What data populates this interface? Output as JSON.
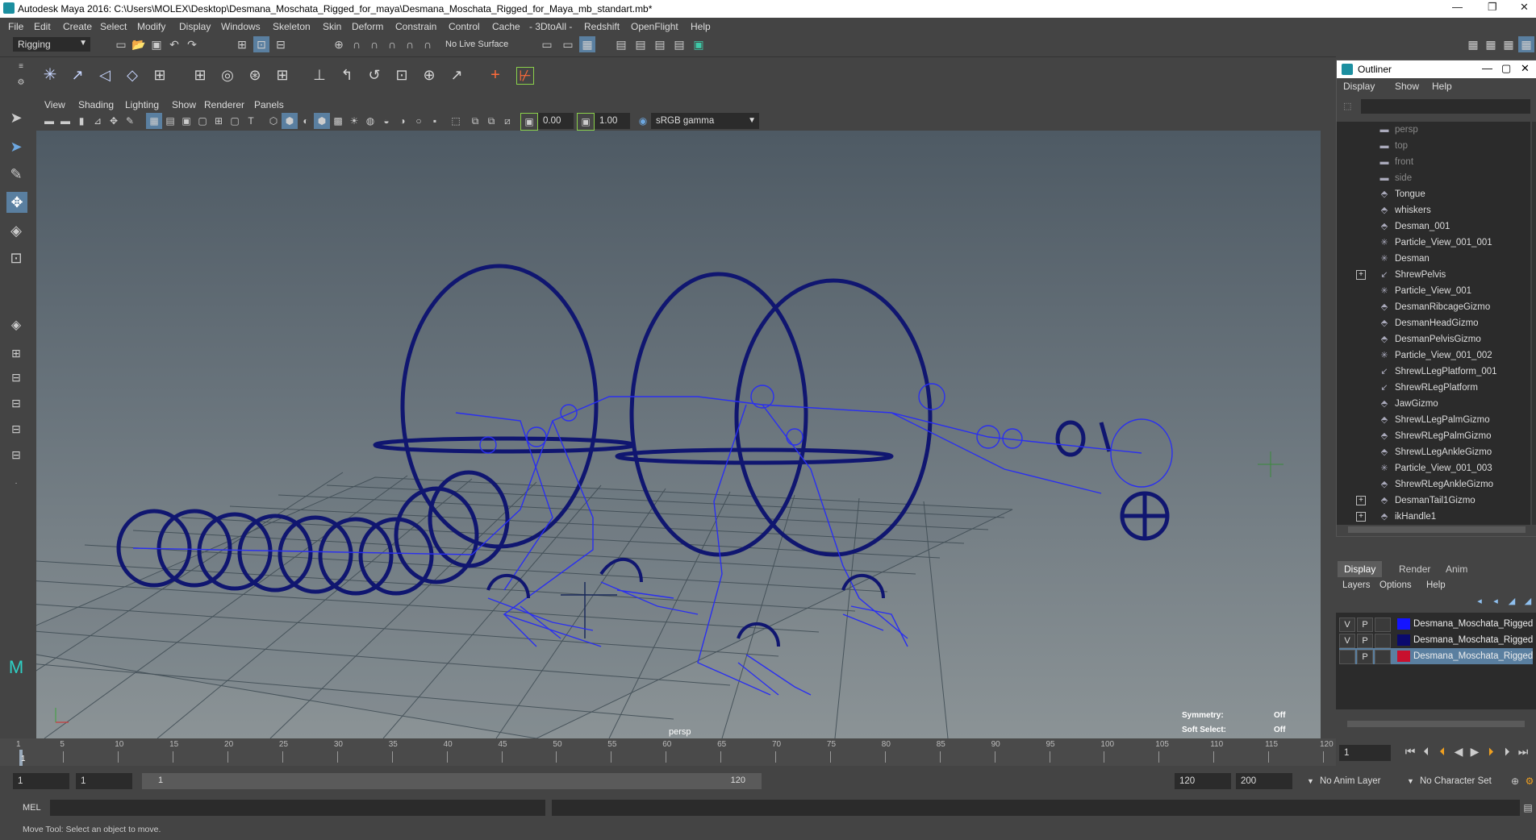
{
  "window": {
    "title": "Autodesk Maya 2016: C:\\Users\\MOLEX\\Desktop\\Desmana_Moschata_Rigged_for_maya\\Desmana_Moschata_Rigged_for_Maya_mb_standart.mb*"
  },
  "menu": [
    "File",
    "Edit",
    "Create",
    "Select",
    "Modify",
    "Display",
    "Windows",
    "Skeleton",
    "Skin",
    "Deform",
    "Constrain",
    "Control",
    "Cache",
    "- 3DtoAll -",
    "Redshift",
    "OpenFlight",
    "Help"
  ],
  "status": {
    "mode": "Rigging",
    "live_surface": "No Live Surface"
  },
  "viewport": {
    "menu": [
      "View",
      "Shading",
      "Lighting",
      "Show",
      "Renderer",
      "Panels"
    ],
    "near": "0.00",
    "far": "1.00",
    "color_space": "sRGB gamma",
    "camera": "persp",
    "symmetry_label": "Symmetry:",
    "symmetry_value": "Off",
    "soft_label": "Soft Select:",
    "soft_value": "Off"
  },
  "outliner": {
    "title": "Outliner",
    "menu": [
      "Display",
      "Show",
      "Help"
    ],
    "items": [
      {
        "label": "persp",
        "icon": "camera-icon",
        "dim": true,
        "expand": false
      },
      {
        "label": "top",
        "icon": "camera-icon",
        "dim": true,
        "expand": false
      },
      {
        "label": "front",
        "icon": "camera-icon",
        "dim": true,
        "expand": false
      },
      {
        "label": "side",
        "icon": "camera-icon",
        "dim": true,
        "expand": false
      },
      {
        "label": "Tongue",
        "icon": "curve-icon",
        "dim": false,
        "expand": false
      },
      {
        "label": "whiskers",
        "icon": "curve-icon",
        "dim": false,
        "expand": false
      },
      {
        "label": "Desman_001",
        "icon": "curve-icon",
        "dim": false,
        "expand": false
      },
      {
        "label": "Particle_View_001_001",
        "icon": "particle-icon",
        "dim": false,
        "expand": false
      },
      {
        "label": "Desman",
        "icon": "particle-icon",
        "dim": false,
        "expand": false
      },
      {
        "label": "ShrewPelvis",
        "icon": "joint-icon",
        "dim": false,
        "expand": true
      },
      {
        "label": "Particle_View_001",
        "icon": "particle-icon",
        "dim": false,
        "expand": false
      },
      {
        "label": "DesmanRibcageGizmo",
        "icon": "curve-icon",
        "dim": false,
        "expand": false
      },
      {
        "label": "DesmanHeadGizmo",
        "icon": "curve-icon",
        "dim": false,
        "expand": false
      },
      {
        "label": "DesmanPelvisGizmo",
        "icon": "curve-icon",
        "dim": false,
        "expand": false
      },
      {
        "label": "Particle_View_001_002",
        "icon": "particle-icon",
        "dim": false,
        "expand": false
      },
      {
        "label": "ShrewLLegPlatform_001",
        "icon": "joint-icon",
        "dim": false,
        "expand": false
      },
      {
        "label": "ShrewRLegPlatform",
        "icon": "joint-icon",
        "dim": false,
        "expand": false
      },
      {
        "label": "JawGizmo",
        "icon": "curve-icon",
        "dim": false,
        "expand": false
      },
      {
        "label": "ShrewLLegPalmGizmo",
        "icon": "curve-icon",
        "dim": false,
        "expand": false
      },
      {
        "label": "ShrewRLegPalmGizmo",
        "icon": "curve-icon",
        "dim": false,
        "expand": false
      },
      {
        "label": "ShrewLLegAnkleGizmo",
        "icon": "curve-icon",
        "dim": false,
        "expand": false
      },
      {
        "label": "Particle_View_001_003",
        "icon": "particle-icon",
        "dim": false,
        "expand": false
      },
      {
        "label": "ShrewRLegAnkleGizmo",
        "icon": "curve-icon",
        "dim": false,
        "expand": false
      },
      {
        "label": "DesmanTail1Gizmo",
        "icon": "curve-icon",
        "dim": false,
        "expand": true
      },
      {
        "label": "ikHandle1",
        "icon": "curve-icon",
        "dim": false,
        "expand": true
      }
    ]
  },
  "layers": {
    "tabs": [
      "Display",
      "Render",
      "Anim"
    ],
    "menu": [
      "Layers",
      "Options",
      "Help"
    ],
    "rows": [
      {
        "v": "V",
        "p": "P",
        "color": "#1414ff",
        "name": "Desmana_Moschata_Rigged_"
      },
      {
        "v": "V",
        "p": "P",
        "color": "#0a0a6e",
        "name": "Desmana_Moschata_Rigged_"
      },
      {
        "v": "",
        "p": "P",
        "color": "#c8102e",
        "name": "Desmana_Moschata_Rigged"
      }
    ]
  },
  "timeline": {
    "ticks": [
      "1",
      "5",
      "10",
      "15",
      "20",
      "25",
      "30",
      "35",
      "40",
      "45",
      "50",
      "55",
      "60",
      "65",
      "70",
      "75",
      "80",
      "85",
      "90",
      "95",
      "100",
      "105",
      "110",
      "115",
      "120"
    ],
    "current": "1"
  },
  "range": {
    "start": "1",
    "playback_start": "1",
    "slider_start": "1",
    "slider_end": "120",
    "playback_end": "120",
    "end": "200",
    "anim_layer": "No Anim Layer",
    "character_set": "No Character Set"
  },
  "command": {
    "lang": "MEL"
  },
  "help": {
    "text": "Move Tool: Select an object to move."
  }
}
